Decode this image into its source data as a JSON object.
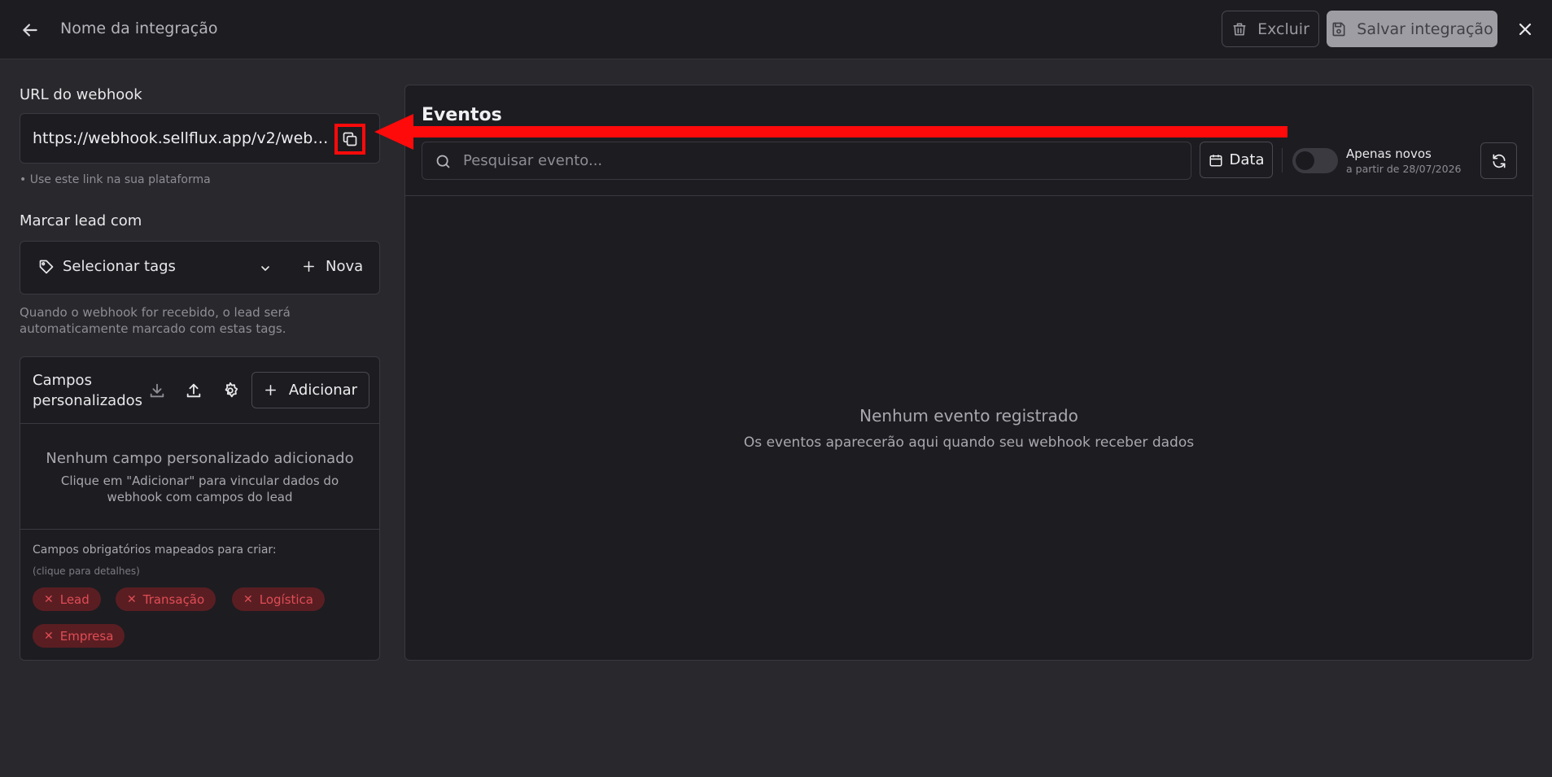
{
  "header": {
    "title": "Nome da integração",
    "delete_label": "Excluir",
    "save_label": "Salvar integração"
  },
  "webhook": {
    "label": "URL do webhook",
    "url": "https://webhook.sellflux.app/v2/webhoo...",
    "hint": "• Use este link na sua plataforma"
  },
  "tags": {
    "label": "Marcar lead com",
    "select_label": "Selecionar tags",
    "new_label": "Nova",
    "hint": "Quando o webhook for recebido, o lead será automaticamente marcado com estas tags."
  },
  "custom_fields": {
    "title": "Campos personalizados",
    "add_label": "Adicionar",
    "empty_title": "Nenhum campo personalizado adicionado",
    "empty_sub": "Clique em \"Adicionar\" para vincular dados do webhook com campos do lead",
    "required_label": "Campos obrigatórios mapeados para criar:",
    "required_hint": "(clique para detalhes)",
    "required_chips": [
      "Lead",
      "Transação",
      "Logística",
      "Empresa"
    ]
  },
  "events": {
    "title": "Eventos",
    "search_placeholder": "Pesquisar evento...",
    "date_label": "Data",
    "toggle_label": "Apenas novos",
    "toggle_sub": "a partir de 28/07/2026",
    "toggle_on": false,
    "empty_title": "Nenhum evento registrado",
    "empty_sub": "Os eventos aparecerão aqui quando seu webhook receber dados"
  },
  "colors": {
    "background": "#29282d",
    "panel": "#1d1c21",
    "chip_bg": "#5a1e22",
    "chip_text": "#e04c55",
    "annotation": "#ff0a0a"
  }
}
